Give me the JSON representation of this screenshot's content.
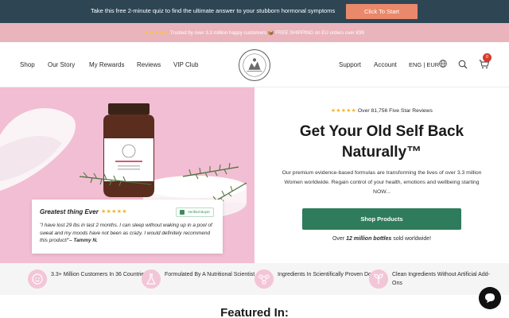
{
  "announcement": {
    "text": "Take this free 2-minute quiz to find the ultimate answer to your stubborn hormonal symptoms",
    "button": "Click To Start"
  },
  "promo": {
    "stars": "★★★★★",
    "text": " Trusted by over 3.3 million happy customers 📦 FREE SHIPPING on EU orders over €99"
  },
  "nav": {
    "left": [
      "Shop",
      "Our Story",
      "My Rewards",
      "Reviews",
      "VIP Club"
    ],
    "right": [
      "Support",
      "Account"
    ],
    "locale": "ENG | EUR",
    "cart_count": "0",
    "icons": [
      "logo-emblem",
      "globe-icon",
      "search-icon",
      "cart-icon"
    ]
  },
  "hero": {
    "rating_stars": "★★★★★",
    "rating_text": " Over 81,756 Five Star Reviews",
    "headline_line1": "Get Your Old Self Back",
    "headline_line2": "Naturally™",
    "subcopy": "Our premium evidence-based formulas are transforming the lives of over 3.3 million Women worldwide. Regain control of your health, emotions and wellbeing starting NOW...",
    "cta": "Shop Products",
    "sold_prefix": "Over ",
    "sold_bold": "12 million bottles",
    "sold_suffix": " sold worldwide!"
  },
  "review": {
    "title": "Greatest thing Ever",
    "stars": "★★★★★",
    "badge": "Verified Buyer",
    "body": "\"I have lost 29 lbs in last 2 months. I can sleep without waking up in a pool of sweat and my moods have not been as crazy. I would definitely recommend this product!\"",
    "author": "– Tammy N."
  },
  "features": [
    {
      "icon": "smiley-icon",
      "text": "3.3+ Million Customers In 36 Countries"
    },
    {
      "icon": "flask-icon",
      "text": "Formulated By A Nutritional Scientist"
    },
    {
      "icon": "molecule-icon",
      "text": "Ingredients In Scientifically Proven Doses"
    },
    {
      "icon": "leaf-icon",
      "text": "Clean Ingredients Without Artificial Add-Ons"
    }
  ],
  "featured_title": "Featured In:",
  "colors": {
    "topbar": "#2e4654",
    "promo_bar": "#eab4bd",
    "cta_orange": "#e9886b",
    "shop_green": "#2e7c5c",
    "hero_pink": "#f2bed3",
    "star_gold": "#f4b221"
  }
}
